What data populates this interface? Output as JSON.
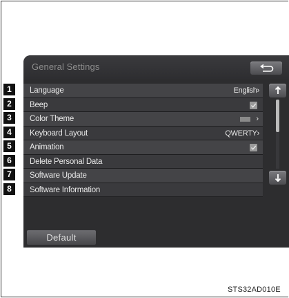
{
  "screen": {
    "title": "General Settings",
    "back_icon": "return-arrow-icon",
    "rows": [
      {
        "label": "Language",
        "value": "English",
        "control": "chevron"
      },
      {
        "label": "Beep",
        "value": "",
        "control": "checkbox",
        "checked": true
      },
      {
        "label": "Color Theme",
        "value": "",
        "control": "swatch-chevron"
      },
      {
        "label": "Keyboard Layout",
        "value": "QWERTY",
        "control": "chevron"
      },
      {
        "label": "Animation",
        "value": "",
        "control": "checkbox",
        "checked": true
      },
      {
        "label": "Delete Personal Data",
        "value": "",
        "control": "none"
      },
      {
        "label": "Software Update",
        "value": "",
        "control": "none"
      },
      {
        "label": "Software Information",
        "value": "",
        "control": "none"
      }
    ],
    "chevron": "›",
    "scroll_up_icon": "arrow-up-icon",
    "scroll_down_icon": "arrow-down-icon",
    "default_label": "Default"
  },
  "callouts": [
    "1",
    "2",
    "3",
    "4",
    "5",
    "6",
    "7",
    "8"
  ],
  "figure_code": "STS32AD010E",
  "colors": {
    "screen_bg": "#2d2d2f",
    "row_odd": "#444447",
    "row_even": "#3a3a3d",
    "badge_bg": "#111111"
  }
}
